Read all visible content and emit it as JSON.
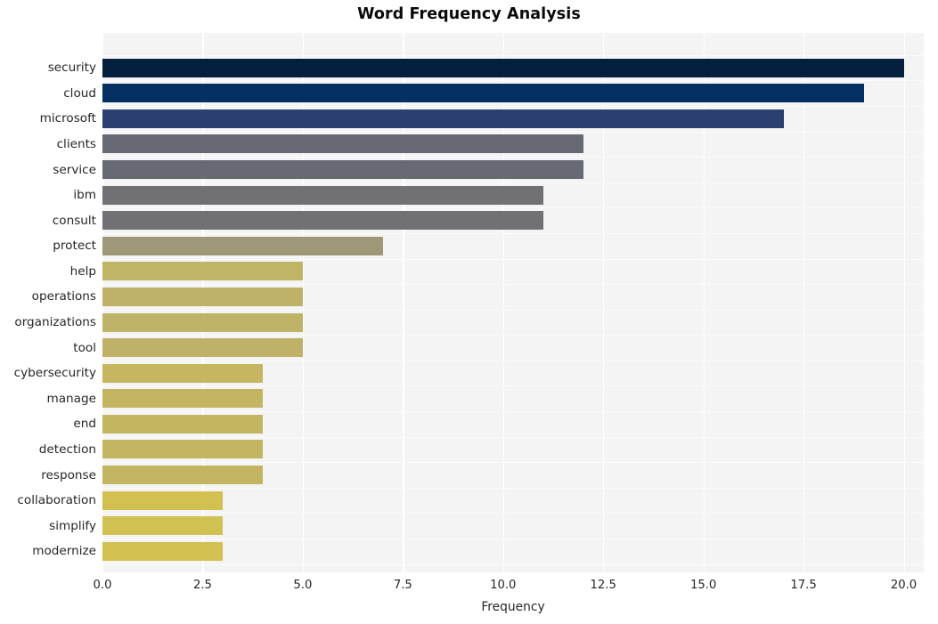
{
  "chart_data": {
    "type": "bar",
    "orientation": "horizontal",
    "title": "Word Frequency Analysis",
    "xlabel": "Frequency",
    "ylabel": "",
    "xlim": [
      0,
      20.5
    ],
    "xticks": [
      "0.0",
      "2.5",
      "5.0",
      "7.5",
      "10.0",
      "12.5",
      "15.0",
      "17.5",
      "20.0"
    ],
    "xtick_values": [
      0,
      2.5,
      5,
      7.5,
      10,
      12.5,
      15,
      17.5,
      20
    ],
    "grid": true,
    "legend": "none",
    "categories": [
      "security",
      "cloud",
      "microsoft",
      "clients",
      "service",
      "ibm",
      "consult",
      "protect",
      "help",
      "operations",
      "organizations",
      "tool",
      "cybersecurity",
      "manage",
      "end",
      "detection",
      "response",
      "collaboration",
      "simplify",
      "modernize"
    ],
    "values": [
      20,
      19,
      17,
      12,
      12,
      11,
      11,
      7,
      5,
      5,
      5,
      5,
      4,
      4,
      4,
      4,
      4,
      3,
      3,
      3
    ],
    "bar_colors": [
      "#05203f",
      "#032f62",
      "#2b3f71",
      "#666973",
      "#676a72",
      "#707075",
      "#717175",
      "#9e9878",
      "#c0b467",
      "#bfb268",
      "#bfb368",
      "#bfb268",
      "#c5b65f",
      "#c3b462",
      "#c4b560",
      "#c3b461",
      "#c3b461",
      "#d2c051",
      "#d1c052",
      "#d2c051"
    ],
    "plot_background": "#f4f4f4",
    "gridline_color": "#ffffff",
    "title_color": "#0a0a0a",
    "tick_color": "#262626"
  }
}
